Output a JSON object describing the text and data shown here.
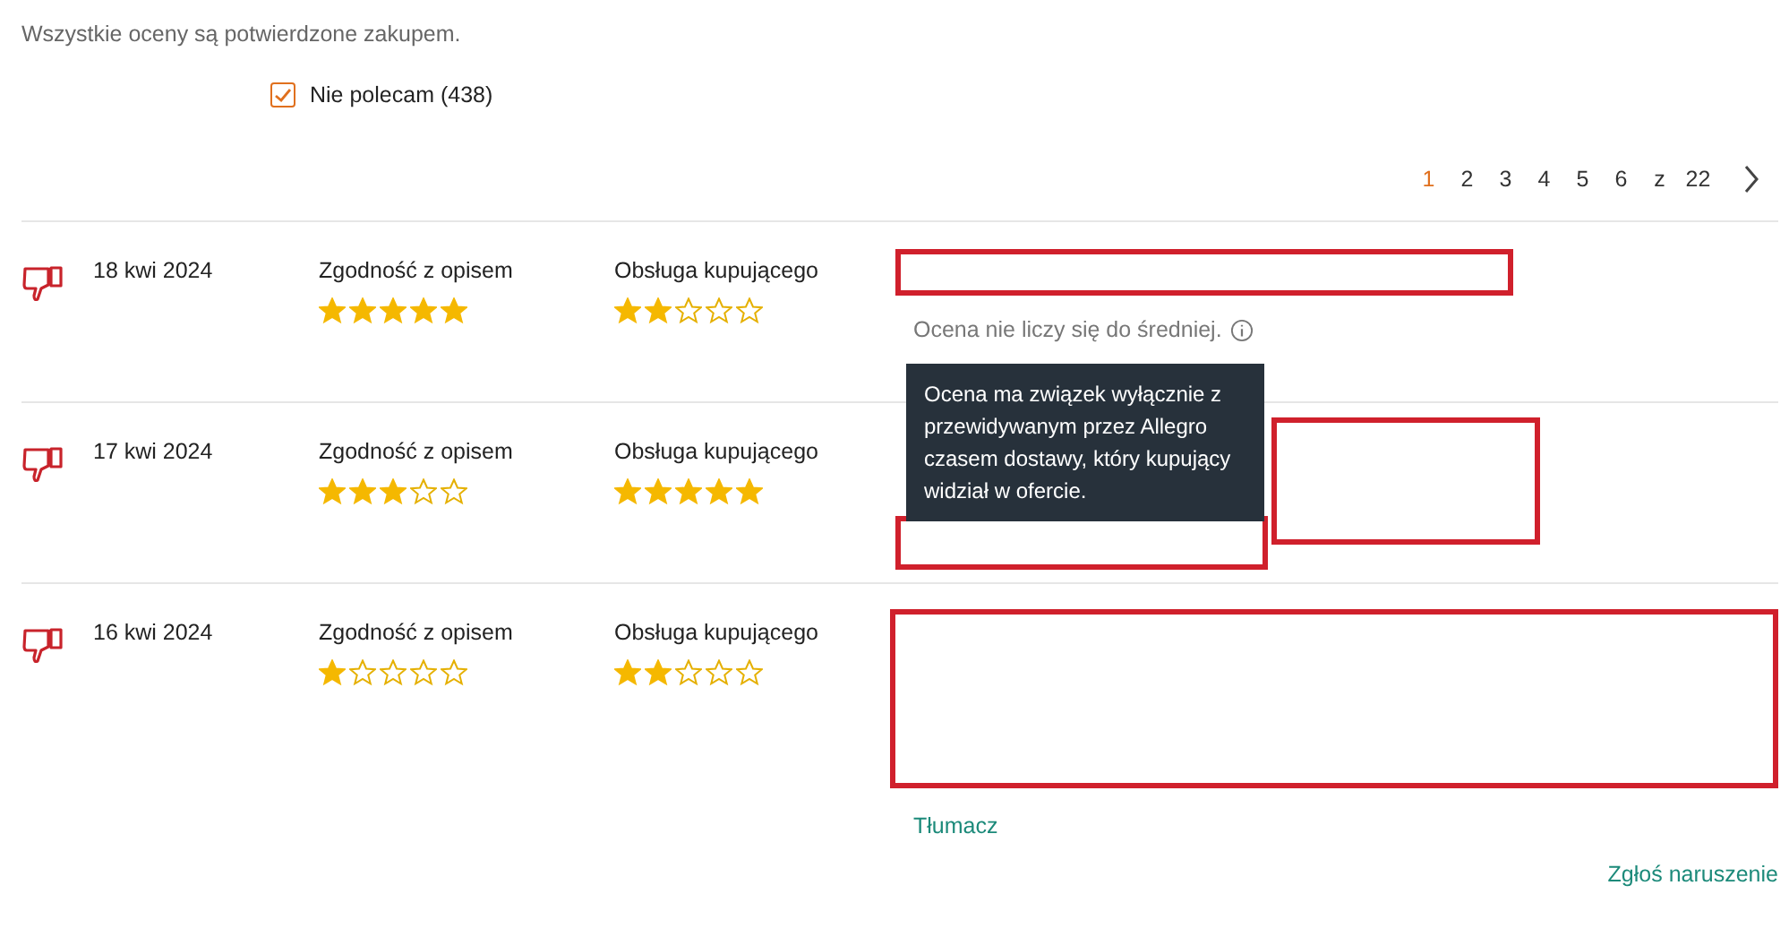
{
  "header_note": "Wszystkie oceny są potwierdzone zakupem.",
  "filter": {
    "label": "Nie polecam (438)",
    "checked": true
  },
  "pagination": {
    "pages": [
      {
        "label": "1",
        "selected": true
      },
      {
        "label": "2",
        "selected": false
      },
      {
        "label": "3",
        "selected": false
      },
      {
        "label": "4",
        "selected": false
      },
      {
        "label": "5",
        "selected": false
      },
      {
        "label": "6",
        "selected": false
      }
    ],
    "of_label": "z",
    "total": "22"
  },
  "reviews": [
    {
      "date": "18 kwi 2024",
      "ratings": [
        {
          "label": "Zgodność z opisem",
          "stars": 5
        },
        {
          "label": "Obsługa kupującego",
          "stars": 2
        }
      ],
      "body": [
        {
          "kind": "redaction"
        },
        {
          "kind": "note",
          "text": "Ocena nie liczy się do średniej."
        }
      ],
      "tooltip": "Ocena ma związek wyłącznie z przewidywanym przez Allegro czasem dostawy, który kupujący widział w ofercie."
    },
    {
      "date": "17 kwi 2024",
      "ratings": [
        {
          "label": "Zgodność z opisem",
          "stars": 3
        },
        {
          "label": "Obsługa kupującego",
          "stars": 5
        }
      ],
      "body": [
        {
          "kind": "redaction"
        },
        {
          "kind": "redaction"
        }
      ]
    },
    {
      "date": "16 kwi 2024",
      "ratings": [
        {
          "label": "Zgodność z opisem",
          "stars": 1
        },
        {
          "label": "Obsługa kupującego",
          "stars": 2
        }
      ],
      "body": [
        {
          "kind": "redaction"
        },
        {
          "kind": "link",
          "text": "Tłumacz"
        }
      ],
      "report": "Zgłoś naruszenie"
    }
  ]
}
